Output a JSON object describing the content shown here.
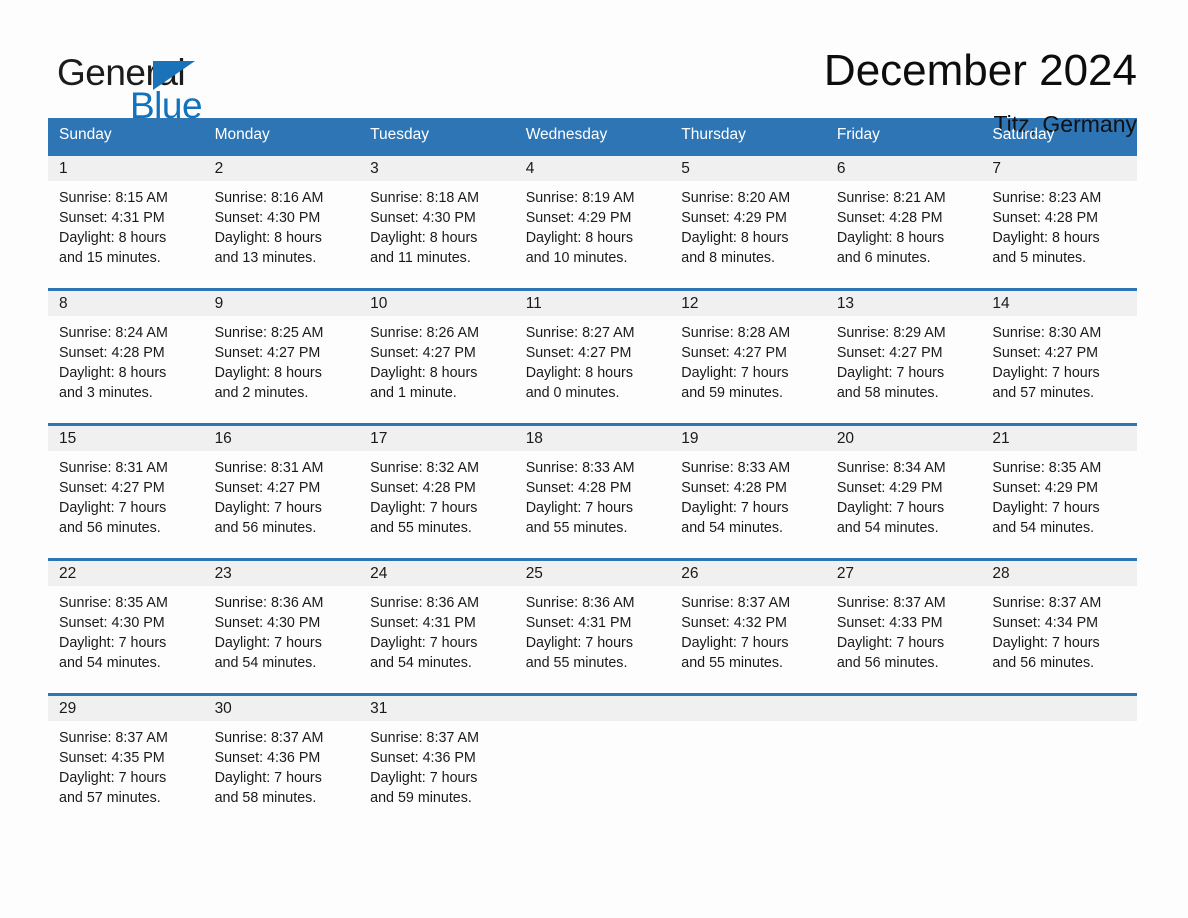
{
  "brand": {
    "name_part1": "General",
    "name_part2": "Blue",
    "triangle_icon": "triangle-icon",
    "accent_color": "#1273bd"
  },
  "header": {
    "title": "December 2024",
    "location": "Titz, Germany"
  },
  "theme": {
    "header_blue": "#2e75b6",
    "row_divider_blue": "#2e75b6",
    "daynum_band_gray": "#f0f0f0",
    "page_background": "#fdfdfd",
    "text_color": "#1a1a1a"
  },
  "calendar": {
    "weekday_headers": [
      "Sunday",
      "Monday",
      "Tuesday",
      "Wednesday",
      "Thursday",
      "Friday",
      "Saturday"
    ],
    "weeks": [
      [
        {
          "day": "1",
          "sunrise": "Sunrise: 8:15 AM",
          "sunset": "Sunset: 4:31 PM",
          "daylight_line1": "Daylight: 8 hours",
          "daylight_line2": "and 15 minutes."
        },
        {
          "day": "2",
          "sunrise": "Sunrise: 8:16 AM",
          "sunset": "Sunset: 4:30 PM",
          "daylight_line1": "Daylight: 8 hours",
          "daylight_line2": "and 13 minutes."
        },
        {
          "day": "3",
          "sunrise": "Sunrise: 8:18 AM",
          "sunset": "Sunset: 4:30 PM",
          "daylight_line1": "Daylight: 8 hours",
          "daylight_line2": "and 11 minutes."
        },
        {
          "day": "4",
          "sunrise": "Sunrise: 8:19 AM",
          "sunset": "Sunset: 4:29 PM",
          "daylight_line1": "Daylight: 8 hours",
          "daylight_line2": "and 10 minutes."
        },
        {
          "day": "5",
          "sunrise": "Sunrise: 8:20 AM",
          "sunset": "Sunset: 4:29 PM",
          "daylight_line1": "Daylight: 8 hours",
          "daylight_line2": "and 8 minutes."
        },
        {
          "day": "6",
          "sunrise": "Sunrise: 8:21 AM",
          "sunset": "Sunset: 4:28 PM",
          "daylight_line1": "Daylight: 8 hours",
          "daylight_line2": "and 6 minutes."
        },
        {
          "day": "7",
          "sunrise": "Sunrise: 8:23 AM",
          "sunset": "Sunset: 4:28 PM",
          "daylight_line1": "Daylight: 8 hours",
          "daylight_line2": "and 5 minutes."
        }
      ],
      [
        {
          "day": "8",
          "sunrise": "Sunrise: 8:24 AM",
          "sunset": "Sunset: 4:28 PM",
          "daylight_line1": "Daylight: 8 hours",
          "daylight_line2": "and 3 minutes."
        },
        {
          "day": "9",
          "sunrise": "Sunrise: 8:25 AM",
          "sunset": "Sunset: 4:27 PM",
          "daylight_line1": "Daylight: 8 hours",
          "daylight_line2": "and 2 minutes."
        },
        {
          "day": "10",
          "sunrise": "Sunrise: 8:26 AM",
          "sunset": "Sunset: 4:27 PM",
          "daylight_line1": "Daylight: 8 hours",
          "daylight_line2": "and 1 minute."
        },
        {
          "day": "11",
          "sunrise": "Sunrise: 8:27 AM",
          "sunset": "Sunset: 4:27 PM",
          "daylight_line1": "Daylight: 8 hours",
          "daylight_line2": "and 0 minutes."
        },
        {
          "day": "12",
          "sunrise": "Sunrise: 8:28 AM",
          "sunset": "Sunset: 4:27 PM",
          "daylight_line1": "Daylight: 7 hours",
          "daylight_line2": "and 59 minutes."
        },
        {
          "day": "13",
          "sunrise": "Sunrise: 8:29 AM",
          "sunset": "Sunset: 4:27 PM",
          "daylight_line1": "Daylight: 7 hours",
          "daylight_line2": "and 58 minutes."
        },
        {
          "day": "14",
          "sunrise": "Sunrise: 8:30 AM",
          "sunset": "Sunset: 4:27 PM",
          "daylight_line1": "Daylight: 7 hours",
          "daylight_line2": "and 57 minutes."
        }
      ],
      [
        {
          "day": "15",
          "sunrise": "Sunrise: 8:31 AM",
          "sunset": "Sunset: 4:27 PM",
          "daylight_line1": "Daylight: 7 hours",
          "daylight_line2": "and 56 minutes."
        },
        {
          "day": "16",
          "sunrise": "Sunrise: 8:31 AM",
          "sunset": "Sunset: 4:27 PM",
          "daylight_line1": "Daylight: 7 hours",
          "daylight_line2": "and 56 minutes."
        },
        {
          "day": "17",
          "sunrise": "Sunrise: 8:32 AM",
          "sunset": "Sunset: 4:28 PM",
          "daylight_line1": "Daylight: 7 hours",
          "daylight_line2": "and 55 minutes."
        },
        {
          "day": "18",
          "sunrise": "Sunrise: 8:33 AM",
          "sunset": "Sunset: 4:28 PM",
          "daylight_line1": "Daylight: 7 hours",
          "daylight_line2": "and 55 minutes."
        },
        {
          "day": "19",
          "sunrise": "Sunrise: 8:33 AM",
          "sunset": "Sunset: 4:28 PM",
          "daylight_line1": "Daylight: 7 hours",
          "daylight_line2": "and 54 minutes."
        },
        {
          "day": "20",
          "sunrise": "Sunrise: 8:34 AM",
          "sunset": "Sunset: 4:29 PM",
          "daylight_line1": "Daylight: 7 hours",
          "daylight_line2": "and 54 minutes."
        },
        {
          "day": "21",
          "sunrise": "Sunrise: 8:35 AM",
          "sunset": "Sunset: 4:29 PM",
          "daylight_line1": "Daylight: 7 hours",
          "daylight_line2": "and 54 minutes."
        }
      ],
      [
        {
          "day": "22",
          "sunrise": "Sunrise: 8:35 AM",
          "sunset": "Sunset: 4:30 PM",
          "daylight_line1": "Daylight: 7 hours",
          "daylight_line2": "and 54 minutes."
        },
        {
          "day": "23",
          "sunrise": "Sunrise: 8:36 AM",
          "sunset": "Sunset: 4:30 PM",
          "daylight_line1": "Daylight: 7 hours",
          "daylight_line2": "and 54 minutes."
        },
        {
          "day": "24",
          "sunrise": "Sunrise: 8:36 AM",
          "sunset": "Sunset: 4:31 PM",
          "daylight_line1": "Daylight: 7 hours",
          "daylight_line2": "and 54 minutes."
        },
        {
          "day": "25",
          "sunrise": "Sunrise: 8:36 AM",
          "sunset": "Sunset: 4:31 PM",
          "daylight_line1": "Daylight: 7 hours",
          "daylight_line2": "and 55 minutes."
        },
        {
          "day": "26",
          "sunrise": "Sunrise: 8:37 AM",
          "sunset": "Sunset: 4:32 PM",
          "daylight_line1": "Daylight: 7 hours",
          "daylight_line2": "and 55 minutes."
        },
        {
          "day": "27",
          "sunrise": "Sunrise: 8:37 AM",
          "sunset": "Sunset: 4:33 PM",
          "daylight_line1": "Daylight: 7 hours",
          "daylight_line2": "and 56 minutes."
        },
        {
          "day": "28",
          "sunrise": "Sunrise: 8:37 AM",
          "sunset": "Sunset: 4:34 PM",
          "daylight_line1": "Daylight: 7 hours",
          "daylight_line2": "and 56 minutes."
        }
      ],
      [
        {
          "day": "29",
          "sunrise": "Sunrise: 8:37 AM",
          "sunset": "Sunset: 4:35 PM",
          "daylight_line1": "Daylight: 7 hours",
          "daylight_line2": "and 57 minutes."
        },
        {
          "day": "30",
          "sunrise": "Sunrise: 8:37 AM",
          "sunset": "Sunset: 4:36 PM",
          "daylight_line1": "Daylight: 7 hours",
          "daylight_line2": "and 58 minutes."
        },
        {
          "day": "31",
          "sunrise": "Sunrise: 8:37 AM",
          "sunset": "Sunset: 4:36 PM",
          "daylight_line1": "Daylight: 7 hours",
          "daylight_line2": "and 59 minutes."
        },
        {
          "day": "",
          "sunrise": "",
          "sunset": "",
          "daylight_line1": "",
          "daylight_line2": ""
        },
        {
          "day": "",
          "sunrise": "",
          "sunset": "",
          "daylight_line1": "",
          "daylight_line2": ""
        },
        {
          "day": "",
          "sunrise": "",
          "sunset": "",
          "daylight_line1": "",
          "daylight_line2": ""
        },
        {
          "day": "",
          "sunrise": "",
          "sunset": "",
          "daylight_line1": "",
          "daylight_line2": ""
        }
      ]
    ]
  }
}
